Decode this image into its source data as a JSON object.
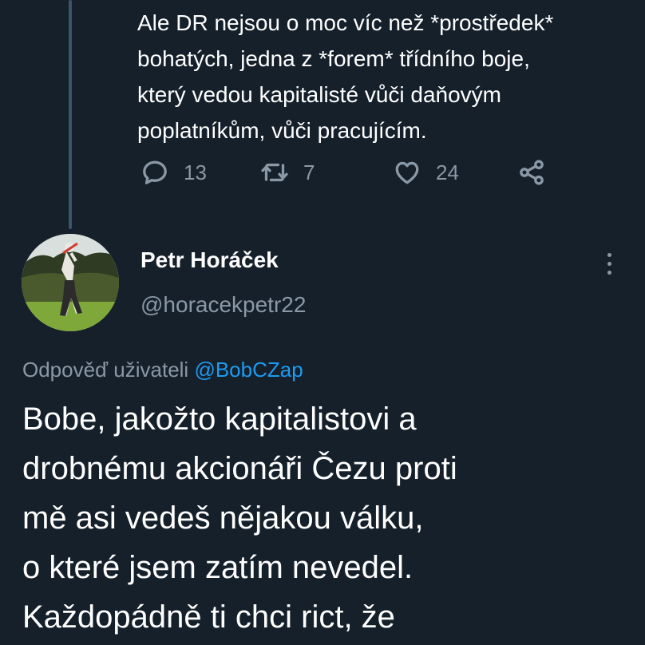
{
  "previous_tweet": {
    "text": "Ale DR nejsou o moc víc než *prostředek*\nbohatých, jedna z *forem* třídního boje,\nkterý vedou kapitalisté vůči daňovým\npoplatníkům, vůči pracujícím.",
    "replies": "13",
    "retweets": "7",
    "likes": "24"
  },
  "tweet": {
    "author_name": "Petr Horáček",
    "author_handle": "@horacekpetr22",
    "reply_prefix": "Odpověď uživateli",
    "reply_mention": "@BobCZap",
    "text": "Bobe, jakožto kapitalistovi a\ndrobnému akcionáři Čezu proti\nmě asi vedeš nějakou válku,\no které jsem zatím nevedel.\nKaždopádně  ti chci rict, že"
  },
  "theme": {
    "background": "#15202b",
    "text": "#ffffff",
    "secondary": "#8b98a5",
    "accent": "#1d9bf0"
  },
  "icons": {
    "reply": "reply-icon",
    "retweet": "retweet-icon",
    "like": "heart-icon",
    "share": "share-icon",
    "more": "more-icon"
  }
}
